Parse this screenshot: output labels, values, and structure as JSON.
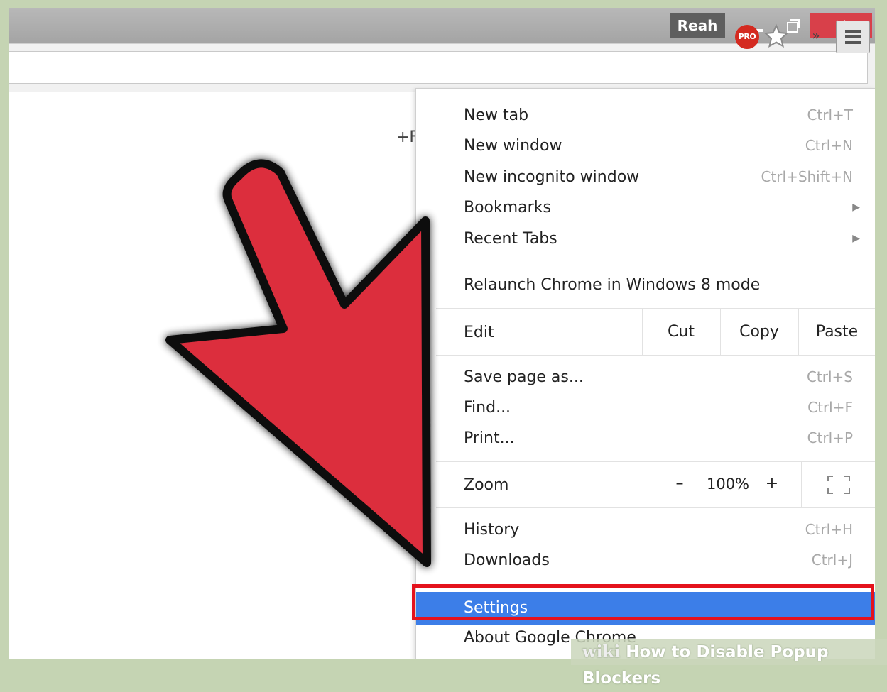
{
  "window": {
    "profile_name": "Reah",
    "minimize_icon": "minimize-icon",
    "maximize_icon": "restore-icon",
    "close_icon": "close-icon",
    "close_glyph": "✕",
    "close_color": "#d8404a"
  },
  "toolbar": {
    "extension_badge": "PRO",
    "extension_color": "#d42a20",
    "star_icon": "bookmark-star-icon",
    "overflow_glyph": "»",
    "menu_icon": "hamburger-menu-icon"
  },
  "page": {
    "partial_text": "+F"
  },
  "menu": {
    "items_top": [
      {
        "label": "New tab",
        "shortcut": "Ctrl+T"
      },
      {
        "label": "New window",
        "shortcut": "Ctrl+N"
      },
      {
        "label": "New incognito window",
        "shortcut": "Ctrl+Shift+N"
      },
      {
        "label": "Bookmarks",
        "submenu": "▶"
      },
      {
        "label": "Recent Tabs",
        "submenu": "▶"
      }
    ],
    "relaunch": "Relaunch Chrome in Windows 8 mode",
    "edit": {
      "label": "Edit",
      "cut": "Cut",
      "copy": "Copy",
      "paste": "Paste"
    },
    "items_mid": [
      {
        "label": "Save page as...",
        "shortcut": "Ctrl+S"
      },
      {
        "label": "Find...",
        "shortcut": "Ctrl+F"
      },
      {
        "label": "Print...",
        "shortcut": "Ctrl+P"
      }
    ],
    "zoom": {
      "label": "Zoom",
      "minus": "–",
      "value": "100%",
      "plus": "+"
    },
    "items_low": [
      {
        "label": "History",
        "shortcut": "Ctrl+H"
      },
      {
        "label": "Downloads",
        "shortcut": "Ctrl+J"
      }
    ],
    "settings": "Settings",
    "about": "About Google Chrome",
    "highlight_color": "#3c7ee8",
    "annotation_color": "#e4121c"
  },
  "annotation": {
    "arrow_color": "#dc2f3e"
  },
  "watermark": {
    "brand": "wiki",
    "title": "How to Disable Popup Blockers"
  }
}
